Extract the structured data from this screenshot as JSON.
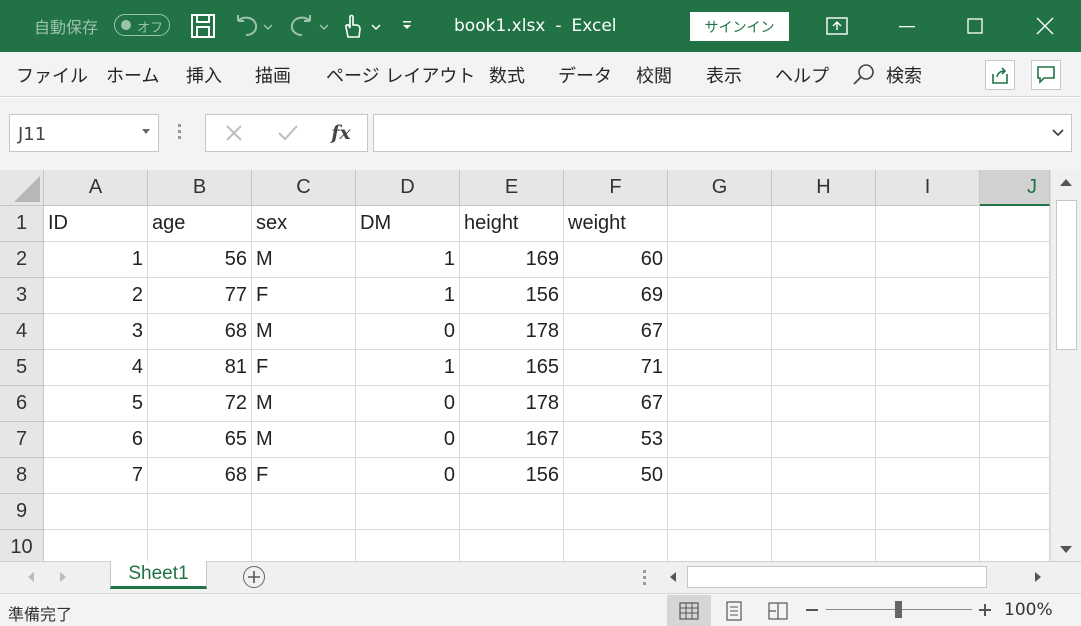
{
  "titlebar": {
    "autosave_label": "自動保存",
    "autosave_toggle": "オフ",
    "filename": "book1.xlsx",
    "separator": "-",
    "app_name": "Excel",
    "signin_label": "サインイン",
    "color": "#217346"
  },
  "ribbon": {
    "tabs": [
      "ファイル",
      "ホーム",
      "挿入",
      "描画",
      "ページ レイアウト",
      "数式",
      "データ",
      "校閲",
      "表示",
      "ヘルプ"
    ],
    "search_label": "検索"
  },
  "formula_bar": {
    "name_box": "J11",
    "fx_label": "fx",
    "formula": ""
  },
  "grid": {
    "columns": [
      "A",
      "B",
      "C",
      "D",
      "E",
      "F",
      "G",
      "H",
      "I",
      "J"
    ],
    "selected_column": "J",
    "row_numbers": [
      "1",
      "2",
      "3",
      "4",
      "5",
      "6",
      "7",
      "8",
      "9",
      "10"
    ],
    "rows": [
      [
        "ID",
        "age",
        "sex",
        "DM",
        "height",
        "weight",
        "",
        "",
        "",
        ""
      ],
      [
        "1",
        "56",
        "M",
        "1",
        "169",
        "60",
        "",
        "",
        "",
        ""
      ],
      [
        "2",
        "77",
        "F",
        "1",
        "156",
        "69",
        "",
        "",
        "",
        ""
      ],
      [
        "3",
        "68",
        "M",
        "0",
        "178",
        "67",
        "",
        "",
        "",
        ""
      ],
      [
        "4",
        "81",
        "F",
        "1",
        "165",
        "71",
        "",
        "",
        "",
        ""
      ],
      [
        "5",
        "72",
        "M",
        "0",
        "178",
        "67",
        "",
        "",
        "",
        ""
      ],
      [
        "6",
        "65",
        "M",
        "0",
        "167",
        "53",
        "",
        "",
        "",
        ""
      ],
      [
        "7",
        "68",
        "F",
        "0",
        "156",
        "50",
        "",
        "",
        "",
        ""
      ],
      [
        "",
        "",
        "",
        "",
        "",
        "",
        "",
        "",
        "",
        ""
      ],
      [
        "",
        "",
        "",
        "",
        "",
        "",
        "",
        "",
        "",
        ""
      ]
    ]
  },
  "sheets": {
    "active": "Sheet1"
  },
  "statusbar": {
    "status": "準備完了",
    "zoom": "100%"
  }
}
